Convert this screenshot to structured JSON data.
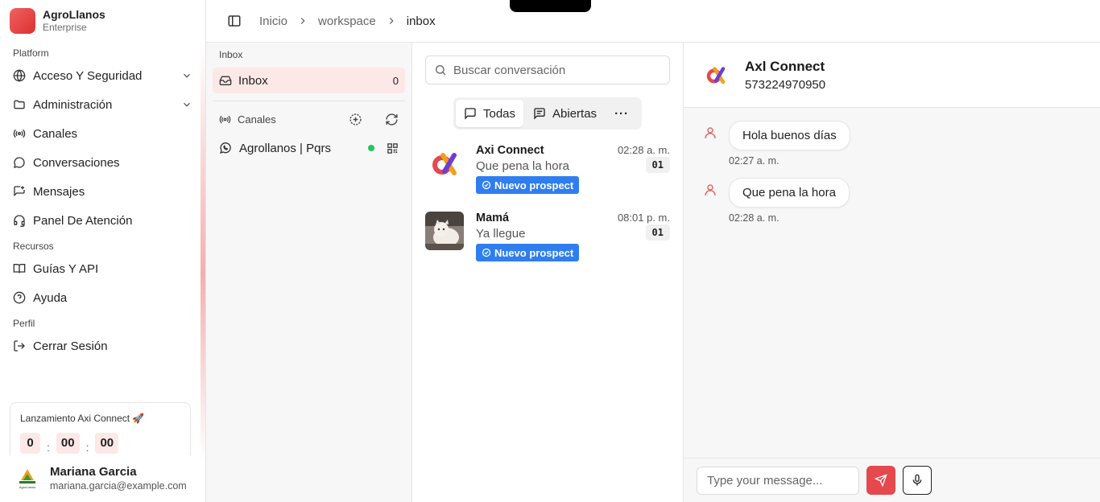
{
  "brand": {
    "name": "AgroLlanos",
    "plan": "Enterprise"
  },
  "sidebar": {
    "platform_title": "Platform",
    "platform_items": [
      {
        "label": "Acceso Y Seguridad",
        "icon": "globe-icon",
        "expandable": true
      },
      {
        "label": "Administración",
        "icon": "folder-icon",
        "expandable": true
      },
      {
        "label": "Canales",
        "icon": "broadcast-icon"
      },
      {
        "label": "Conversaciones",
        "icon": "chat-bubble-icon"
      },
      {
        "label": "Mensajes",
        "icon": "message-square-icon"
      },
      {
        "label": "Panel De Atención",
        "icon": "headset-icon"
      }
    ],
    "resources_title": "Recursos",
    "resources_items": [
      {
        "label": "Guías Y API",
        "icon": "book-icon"
      },
      {
        "label": "Ayuda",
        "icon": "help-circle-icon"
      }
    ],
    "profile_title": "Perfil",
    "profile_items": [
      {
        "label": "Cerrar Sesión",
        "icon": "logout-icon"
      }
    ],
    "countdown": {
      "title": "Lanzamiento Axi Connect 🚀",
      "values": [
        "0",
        "00",
        "00"
      ],
      "separator": ":"
    },
    "user": {
      "name": "Mariana Garcia",
      "email": "mariana.garcia@example.com",
      "logo_text": "AgroLlanos"
    }
  },
  "breadcrumb": {
    "items": [
      "Inicio",
      "workspace",
      "inbox"
    ]
  },
  "inbox_panel": {
    "title": "Inbox",
    "inbox_label": "Inbox",
    "inbox_count": "0",
    "channels_label": "Canales",
    "channel_name": "Agrollanos | Pqrs"
  },
  "conversations": {
    "search_placeholder": "Buscar conversación",
    "filters": {
      "all": "Todas",
      "open": "Abiertas",
      "more": "···"
    },
    "items": [
      {
        "name": "Axi Connect",
        "preview": "Que pena la hora",
        "time": "02:28 a. m.",
        "unread": "01",
        "badge": "Nuevo prospect"
      },
      {
        "name": "Mamá",
        "preview": "Ya llegue",
        "time": "08:01 p. m.",
        "unread": "01",
        "badge": "Nuevo prospect"
      }
    ]
  },
  "chat": {
    "title": "Axl Connect",
    "phone": "573224970950",
    "messages": [
      {
        "text": "Hola buenos días",
        "time": "02:27 a. m."
      },
      {
        "text": "Que pena la hora",
        "time": "02:28 a. m."
      }
    ],
    "input_placeholder": "Type your message..."
  },
  "colors": {
    "accent": "#e5484d",
    "badge": "#2f7ef0",
    "online": "#22c55e",
    "active_bg": "#fde8e8"
  }
}
